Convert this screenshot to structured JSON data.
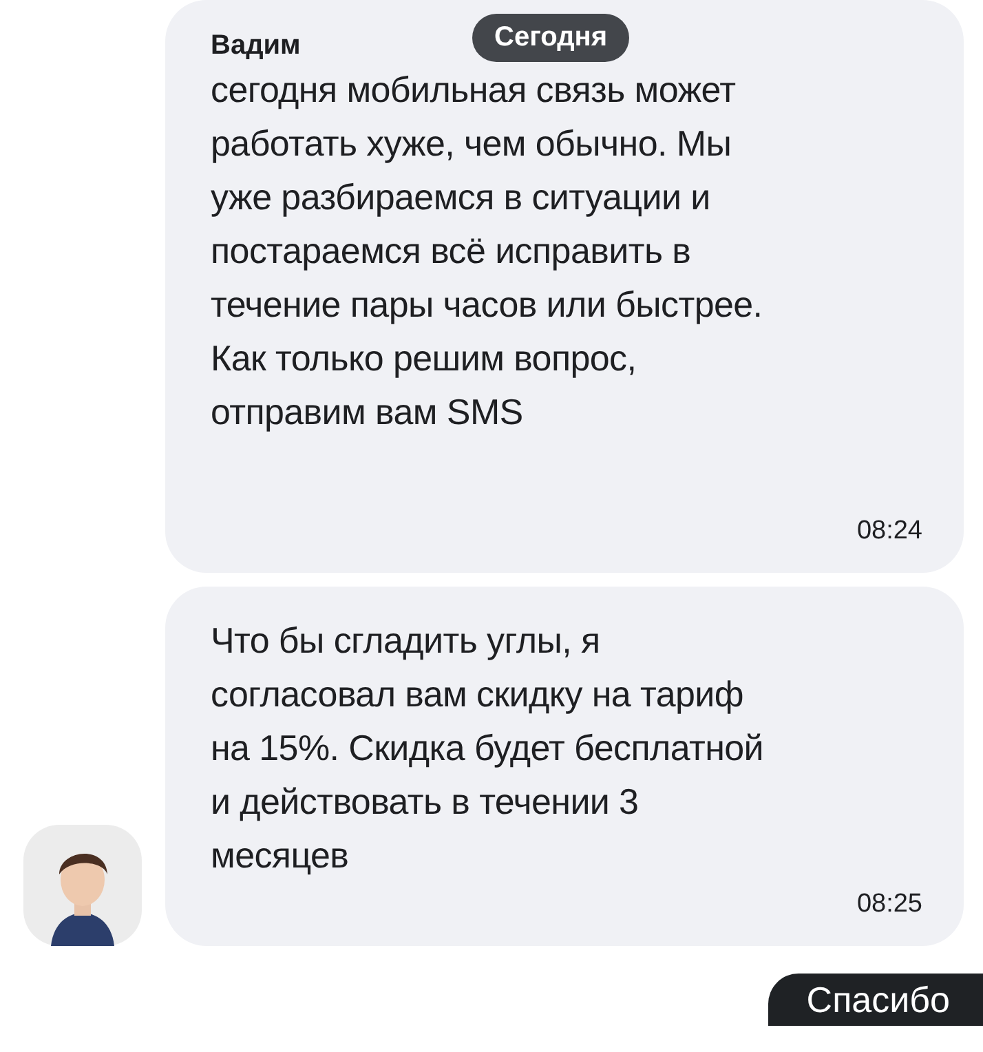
{
  "date_pill": "Сегодня",
  "messages": [
    {
      "sender": "Вадим",
      "text": "сегодня мобильная связь может\nработать хуже, чем обычно. Мы\nуже разбираемся в ситуации и\nпостараемся всё исправить в\nтечение пары часов или быстрее.\nКак только решим вопрос,\nотправим вам SMS",
      "time": "08:24",
      "avatar": false
    },
    {
      "text": "Что бы сгладить углы, я\nсогласовал вам скидку на тариф\nна 15%. Скидка будет бесплатной\nи действовать в течении 3\nмесяцев",
      "time": "08:25",
      "avatar": true
    }
  ],
  "outgoing": {
    "text": "Спасибо"
  }
}
